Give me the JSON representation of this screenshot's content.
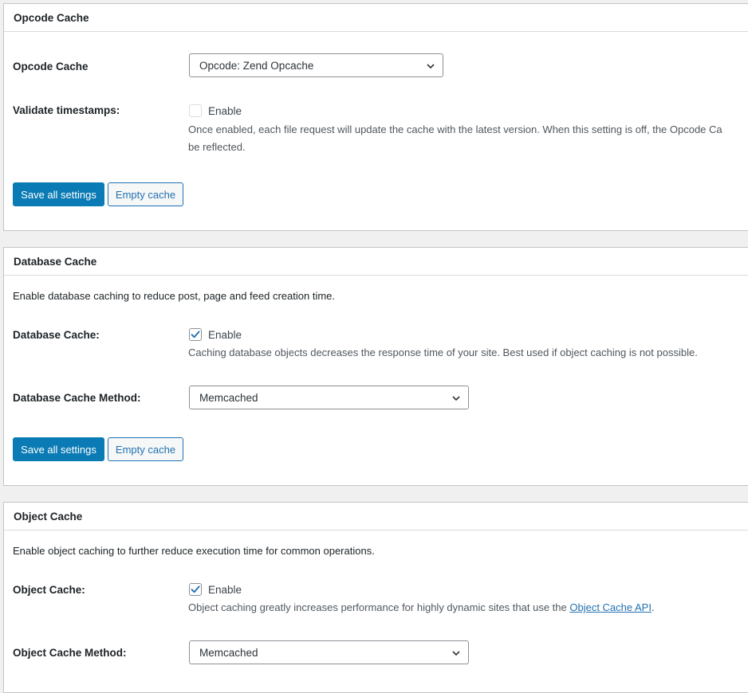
{
  "opcode": {
    "title": "Opcode Cache",
    "method_label": "Opcode Cache",
    "method_value": "Opcode: Zend Opcache",
    "validate_label": "Validate timestamps:",
    "validate_checkbox": "Enable",
    "validate_checked": false,
    "validate_desc_line1": "Once enabled, each file request will update the cache with the latest version. When this setting is off, the Opcode Ca",
    "validate_desc_line2": "be reflected.",
    "save_label": "Save all settings",
    "empty_label": "Empty cache"
  },
  "database": {
    "title": "Database Cache",
    "intro": "Enable database caching to reduce post, page and feed creation time.",
    "enable_label": "Database Cache:",
    "enable_checkbox": "Enable",
    "enable_checked": true,
    "enable_desc": "Caching database objects decreases the response time of your site. Best used if object caching is not possible.",
    "method_label": "Database Cache Method:",
    "method_value": "Memcached",
    "save_label": "Save all settings",
    "empty_label": "Empty cache"
  },
  "object": {
    "title": "Object Cache",
    "intro": "Enable object caching to further reduce execution time for common operations.",
    "enable_label": "Object Cache:",
    "enable_checkbox": "Enable",
    "enable_checked": true,
    "enable_desc_prefix": "Object caching greatly increases performance for highly dynamic sites that use the ",
    "enable_desc_link": "Object Cache API",
    "enable_desc_suffix": ".",
    "method_label": "Object Cache Method:",
    "method_value": "Memcached"
  },
  "colors": {
    "primary_button": "#0a7bb4",
    "link": "#2271b1",
    "checkmark": "#2271b1",
    "page_background": "#f0f0f1"
  },
  "icons": {
    "select_chevron": "chevron-down-icon",
    "checkbox_check": "checkmark-icon"
  }
}
